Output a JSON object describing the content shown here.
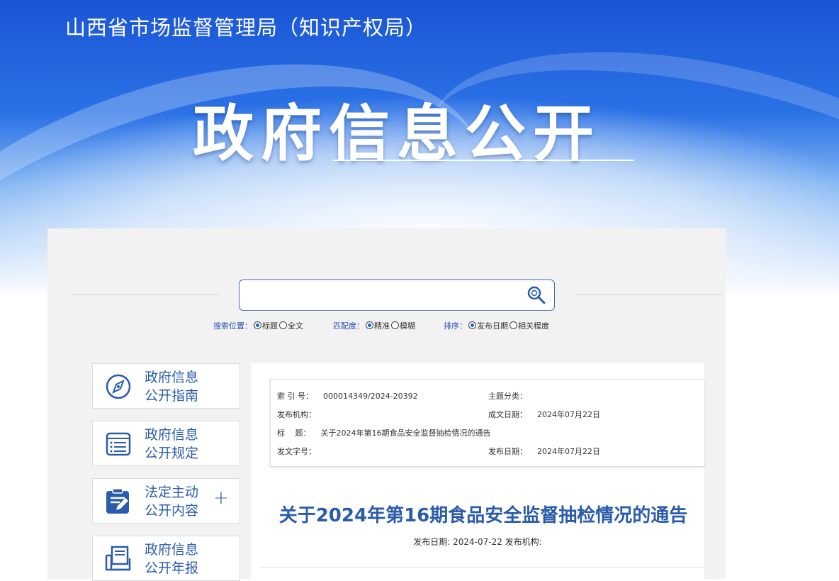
{
  "header": {
    "agency": "山西省市场监督管理局（知识产权局）",
    "title": "政府信息公开"
  },
  "search": {
    "placeholder": "",
    "position_label": "搜索位置：",
    "position_options": [
      "标题",
      "全文"
    ],
    "match_label": "匹配度：",
    "match_options": [
      "精准",
      "模糊"
    ],
    "sort_label": "排序：",
    "sort_options": [
      "发布日期",
      "相关程度"
    ]
  },
  "sidebar": {
    "items": [
      {
        "line1": "政府信息",
        "line2": "公开指南",
        "icon": "compass-icon"
      },
      {
        "line1": "政府信息",
        "line2": "公开规定",
        "icon": "document-list-icon"
      },
      {
        "line1": "法定主动",
        "line2": "公开内容",
        "icon": "clipboard-edit-icon",
        "expand": "+"
      },
      {
        "line1": "政府信息",
        "line2": "公开年报",
        "icon": "folder-document-icon"
      }
    ]
  },
  "meta": {
    "index_label": "索 引 号：",
    "index_value": "000014349/2024-20392",
    "topic_label": "主题分类：",
    "topic_value": "",
    "org_label": "发布机构：",
    "org_value": "",
    "created_label": "成文日期：",
    "created_value": "2024年07月22日",
    "title_label": "标　 题：",
    "title_value": "关于2024年第16期食品安全监督抽检情况的通告",
    "doc_no_label": "发文字号：",
    "doc_no_value": "",
    "published_label": "发布日期：",
    "published_value": "2024年07月22日"
  },
  "article": {
    "title": "关于2024年第16期食品安全监督抽检情况的通告",
    "pub_line": "发布日期: 2024-07-22 发布机构:"
  },
  "colors": {
    "banner_blue": "#1a55d6",
    "link_blue": "#2a5caa",
    "panel_bg": "#f2f2f2"
  }
}
